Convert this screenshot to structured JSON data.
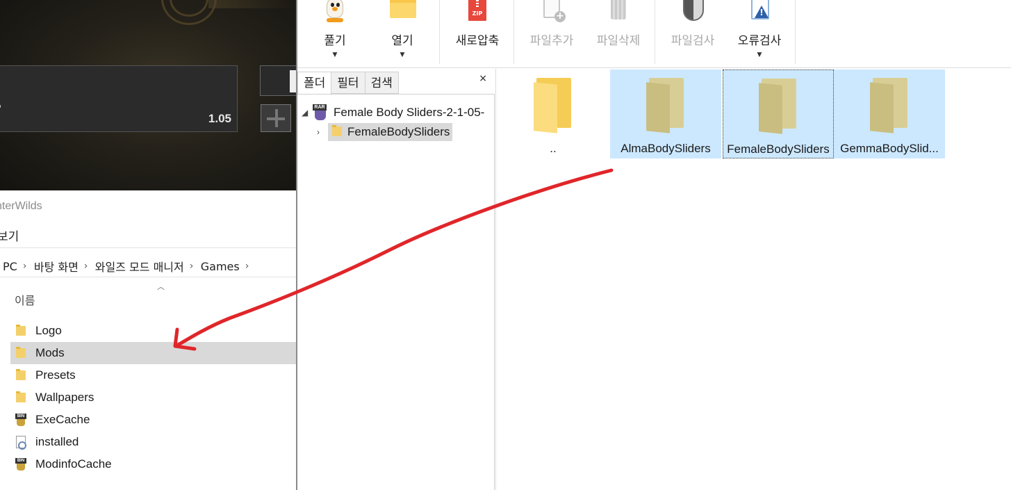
{
  "game": {
    "slider_value": "1.05"
  },
  "explorer": {
    "title": "nterWilds",
    "menu_view": "보기",
    "breadcrumb": [
      "PC",
      "바탕 화면",
      "와일즈 모드 매니저",
      "Games"
    ],
    "column_name": "이름",
    "files": [
      {
        "name": "Logo",
        "icon": "folder-icon",
        "selected": false
      },
      {
        "name": "Mods",
        "icon": "folder-icon",
        "selected": true
      },
      {
        "name": "Presets",
        "icon": "folder-icon",
        "selected": false
      },
      {
        "name": "Wallpapers",
        "icon": "folder-icon",
        "selected": false
      },
      {
        "name": "ExeCache",
        "icon": "bin-file-icon",
        "selected": false
      },
      {
        "name": "installed",
        "icon": "config-file-icon",
        "selected": false
      },
      {
        "name": "ModinfoCache",
        "icon": "bin-file-icon",
        "selected": false
      }
    ]
  },
  "archiver": {
    "toolbar": {
      "extract": "풀기",
      "open": "열기",
      "new_archive": "새로압축",
      "add_files": "파일추가",
      "delete_files": "파일삭제",
      "scan_files": "파일검사",
      "test_archive": "오류검사",
      "icon_badge_zip": "ZIP"
    },
    "tabs": [
      "폴더",
      "필터",
      "검색"
    ],
    "close_glyph": "×",
    "tree": {
      "archive_name": "Female Body Sliders-2-1-05-",
      "archive_badge": "RAR",
      "child_folder": "FemaleBodySliders"
    },
    "items": [
      {
        "name": "..",
        "selected": false,
        "focused": false,
        "up": true
      },
      {
        "name": "AlmaBodySliders",
        "selected": true,
        "focused": false,
        "up": false
      },
      {
        "name": "FemaleBodySliders",
        "selected": true,
        "focused": true,
        "up": false
      },
      {
        "name": "GemmaBodySlid...",
        "selected": true,
        "focused": false,
        "up": false
      }
    ]
  },
  "colors": {
    "selection_blue": "#cce8ff",
    "annotation_red": "#e0262a",
    "list_selected_gray": "#d9d9d9"
  }
}
